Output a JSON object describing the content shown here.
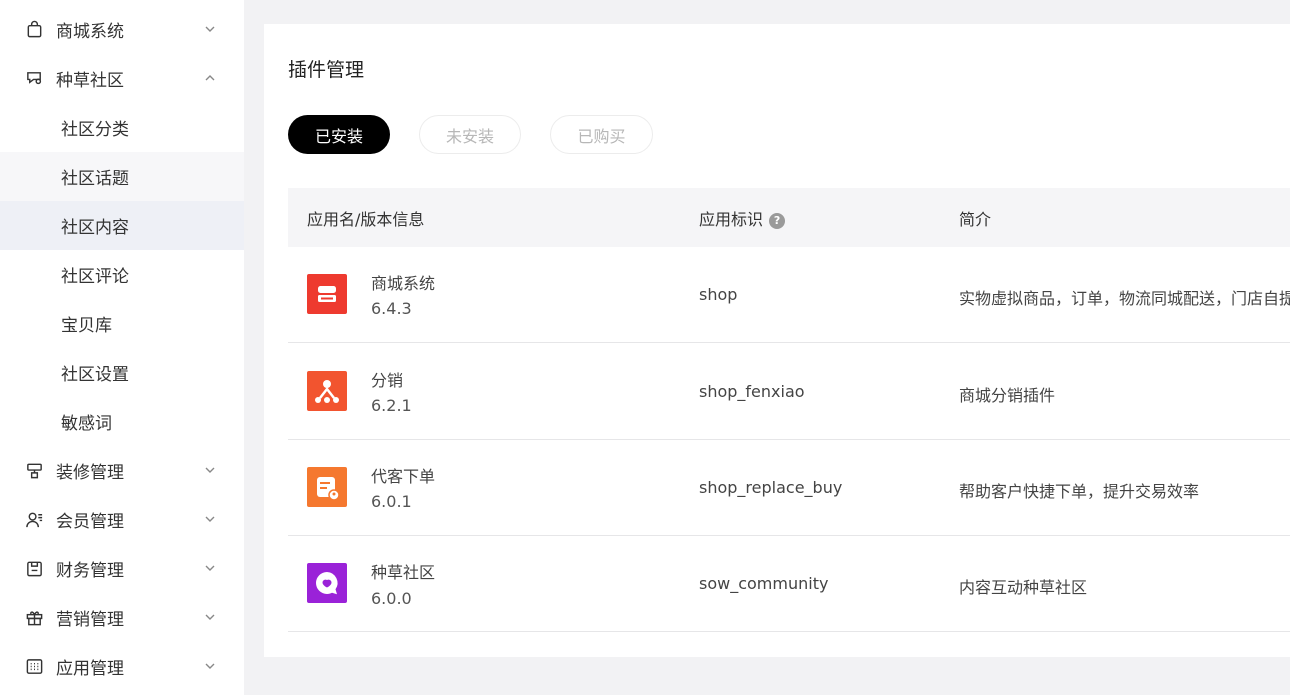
{
  "sidebar": {
    "groups": [
      {
        "label": "商城系统",
        "icon": "shopping-bag-icon",
        "expanded": false
      },
      {
        "label": "种草社区",
        "icon": "community-icon",
        "expanded": true
      },
      {
        "label": "装修管理",
        "icon": "decoration-icon",
        "expanded": false
      },
      {
        "label": "会员管理",
        "icon": "member-icon",
        "expanded": false
      },
      {
        "label": "财务管理",
        "icon": "finance-icon",
        "expanded": false
      },
      {
        "label": "营销管理",
        "icon": "gift-icon",
        "expanded": false
      },
      {
        "label": "应用管理",
        "icon": "apps-icon",
        "expanded": false
      }
    ],
    "community_children": [
      "社区分类",
      "社区话题",
      "社区内容",
      "社区评论",
      "宝贝库",
      "社区设置",
      "敏感词"
    ],
    "active_item": "社区内容"
  },
  "main": {
    "title": "插件管理",
    "tabs": [
      {
        "label": "已安装",
        "active": true
      },
      {
        "label": "未安装",
        "active": false
      },
      {
        "label": "已购买",
        "active": false
      }
    ],
    "table": {
      "headers": [
        "应用名/版本信息",
        "应用标识",
        "简介"
      ],
      "rows": [
        {
          "name": "商城系统",
          "version": "6.4.3",
          "id": "shop",
          "desc": "实物虚拟商品，订单，物流同城配送，门店自提",
          "icon": "shop-app-icon",
          "color": "#ee3a2f"
        },
        {
          "name": "分销",
          "version": "6.2.1",
          "id": "shop_fenxiao",
          "desc": "商城分销插件",
          "icon": "distribution-app-icon",
          "color": "#f2542f"
        },
        {
          "name": "代客下单",
          "version": "6.0.1",
          "id": "shop_replace_buy",
          "desc": "帮助客户快捷下单，提升交易效率",
          "icon": "order-app-icon",
          "color": "#f5782f"
        },
        {
          "name": "种草社区",
          "version": "6.0.0",
          "id": "sow_community",
          "desc": "内容互动种草社区",
          "icon": "community-app-icon",
          "color": "#9a22d8"
        }
      ]
    }
  }
}
